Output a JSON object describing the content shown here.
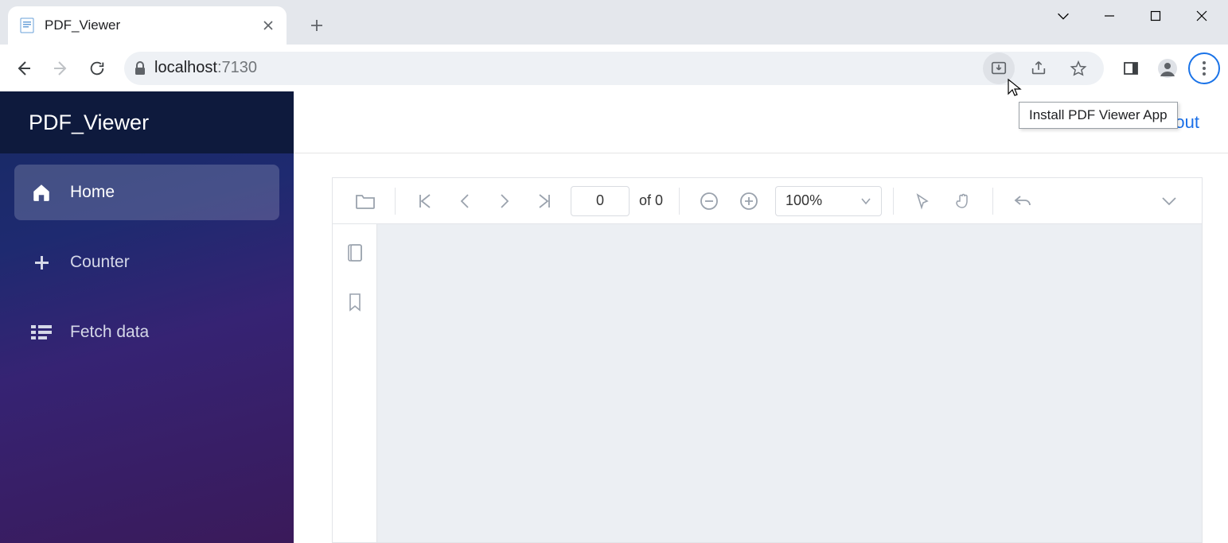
{
  "browser": {
    "tab_title": "PDF_Viewer",
    "url_host": "localhost",
    "url_port": ":7130",
    "tooltip": "Install PDF Viewer App"
  },
  "sidebar": {
    "brand": "PDF_Viewer",
    "items": [
      {
        "label": "Home"
      },
      {
        "label": "Counter"
      },
      {
        "label": "Fetch data"
      }
    ]
  },
  "topbar": {
    "about": "About"
  },
  "viewer": {
    "page_current": "0",
    "page_total_label": "of 0",
    "zoom": "100%"
  }
}
